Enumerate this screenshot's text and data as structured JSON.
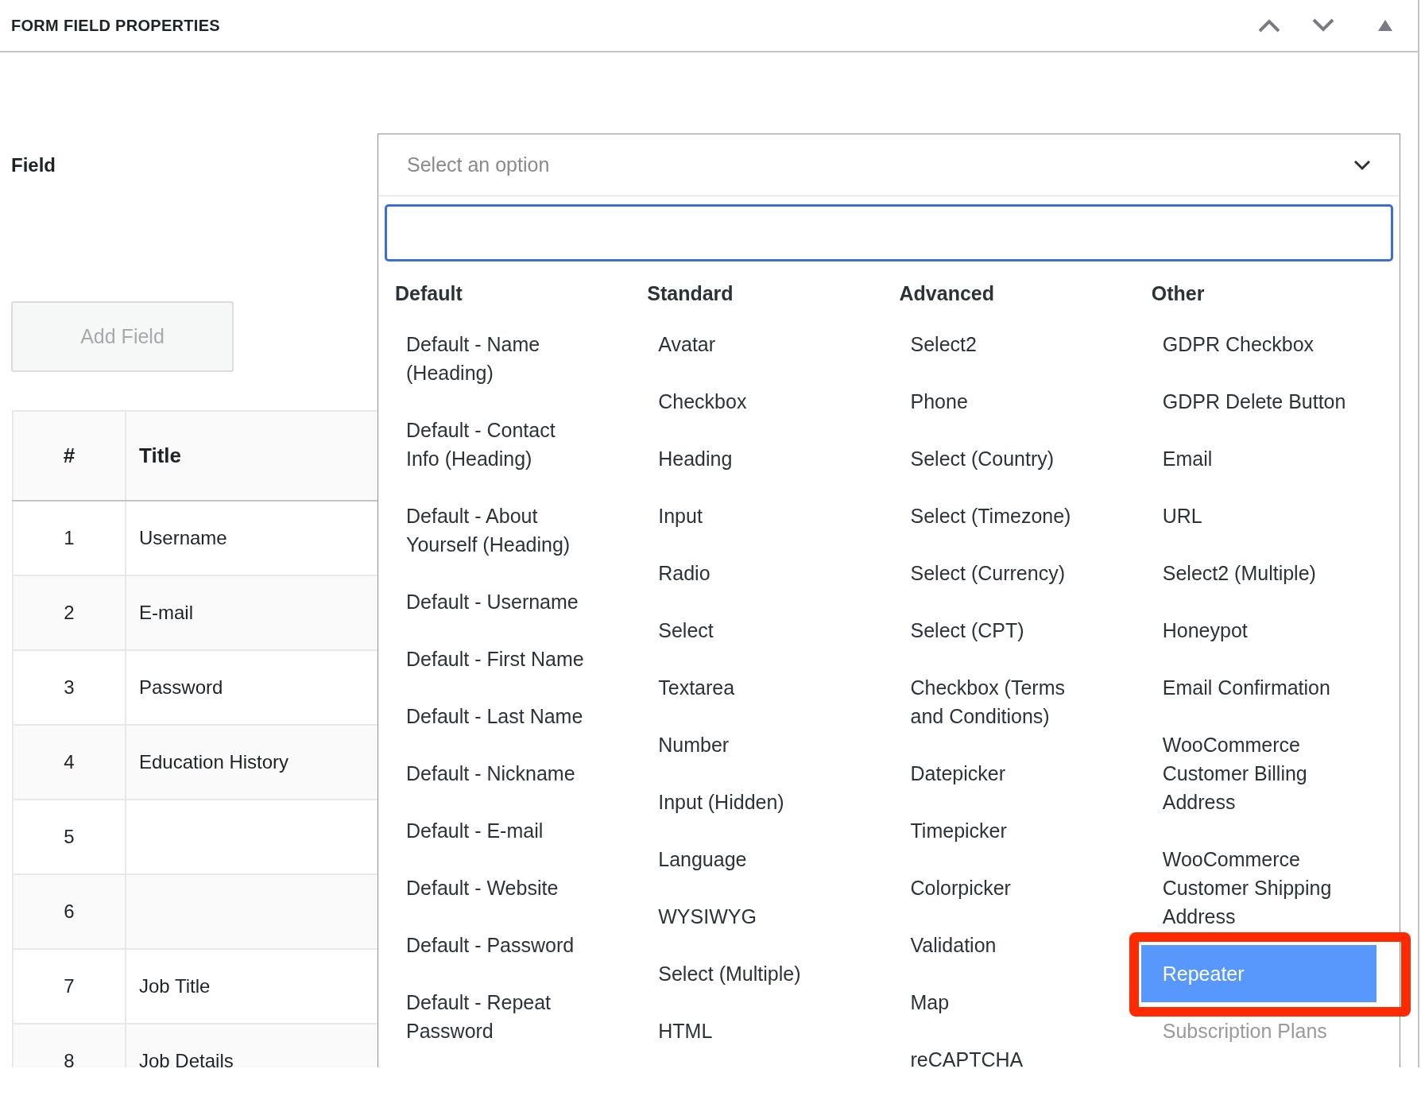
{
  "panel": {
    "title": "FORM FIELD PROPERTIES",
    "controls": [
      {
        "kind": "chevron-up"
      },
      {
        "kind": "chevron-down"
      },
      {
        "kind": "collapse"
      }
    ]
  },
  "field": {
    "label": "Field",
    "select": {
      "placeholder": "Select an option",
      "expanded": true
    }
  },
  "option_groups": [
    {
      "heading": "Default",
      "options": [
        {
          "label": "Default - Name (Heading)",
          "highlighted": false,
          "disabled": false,
          "annotated": false
        },
        {
          "label": "Default - Contact Info (Heading)",
          "highlighted": false,
          "disabled": false,
          "annotated": false
        },
        {
          "label": "Default - About Yourself (Heading)",
          "highlighted": false,
          "disabled": false,
          "annotated": false
        },
        {
          "label": "Default - Username",
          "highlighted": false,
          "disabled": false,
          "annotated": false
        },
        {
          "label": "Default - First Name",
          "highlighted": false,
          "disabled": false,
          "annotated": false
        },
        {
          "label": "Default - Last Name",
          "highlighted": false,
          "disabled": false,
          "annotated": false
        },
        {
          "label": "Default - Nickname",
          "highlighted": false,
          "disabled": false,
          "annotated": false
        },
        {
          "label": "Default - E-mail",
          "highlighted": false,
          "disabled": false,
          "annotated": false
        },
        {
          "label": "Default - Website",
          "highlighted": false,
          "disabled": false,
          "annotated": false
        },
        {
          "label": "Default - Password",
          "highlighted": false,
          "disabled": false,
          "annotated": false
        },
        {
          "label": "Default - Repeat Password",
          "highlighted": false,
          "disabled": false,
          "annotated": false
        }
      ]
    },
    {
      "heading": "Standard",
      "options": [
        {
          "label": "Avatar",
          "highlighted": false,
          "disabled": false,
          "annotated": false
        },
        {
          "label": "Checkbox",
          "highlighted": false,
          "disabled": false,
          "annotated": false
        },
        {
          "label": "Heading",
          "highlighted": false,
          "disabled": false,
          "annotated": false
        },
        {
          "label": "Input",
          "highlighted": false,
          "disabled": false,
          "annotated": false
        },
        {
          "label": "Radio",
          "highlighted": false,
          "disabled": false,
          "annotated": false
        },
        {
          "label": "Select",
          "highlighted": false,
          "disabled": false,
          "annotated": false
        },
        {
          "label": "Textarea",
          "highlighted": false,
          "disabled": false,
          "annotated": false
        },
        {
          "label": "Number",
          "highlighted": false,
          "disabled": false,
          "annotated": false
        },
        {
          "label": "Input (Hidden)",
          "highlighted": false,
          "disabled": false,
          "annotated": false
        },
        {
          "label": "Language",
          "highlighted": false,
          "disabled": false,
          "annotated": false
        },
        {
          "label": "WYSIWYG",
          "highlighted": false,
          "disabled": false,
          "annotated": false
        },
        {
          "label": "Select (Multiple)",
          "highlighted": false,
          "disabled": false,
          "annotated": false
        },
        {
          "label": "HTML",
          "highlighted": false,
          "disabled": false,
          "annotated": false
        }
      ]
    },
    {
      "heading": "Advanced",
      "options": [
        {
          "label": "Select2",
          "highlighted": false,
          "disabled": false,
          "annotated": false
        },
        {
          "label": "Phone",
          "highlighted": false,
          "disabled": false,
          "annotated": false
        },
        {
          "label": "Select (Country)",
          "highlighted": false,
          "disabled": false,
          "annotated": false
        },
        {
          "label": "Select (Timezone)",
          "highlighted": false,
          "disabled": false,
          "annotated": false
        },
        {
          "label": "Select (Currency)",
          "highlighted": false,
          "disabled": false,
          "annotated": false
        },
        {
          "label": "Select (CPT)",
          "highlighted": false,
          "disabled": false,
          "annotated": false
        },
        {
          "label": "Checkbox (Terms and Conditions)",
          "highlighted": false,
          "disabled": false,
          "annotated": false
        },
        {
          "label": "Datepicker",
          "highlighted": false,
          "disabled": false,
          "annotated": false
        },
        {
          "label": "Timepicker",
          "highlighted": false,
          "disabled": false,
          "annotated": false
        },
        {
          "label": "Colorpicker",
          "highlighted": false,
          "disabled": false,
          "annotated": false
        },
        {
          "label": "Validation",
          "highlighted": false,
          "disabled": false,
          "annotated": false
        },
        {
          "label": "Map",
          "highlighted": false,
          "disabled": false,
          "annotated": false
        },
        {
          "label": "reCAPTCHA",
          "highlighted": false,
          "disabled": false,
          "annotated": false
        }
      ]
    },
    {
      "heading": "Other",
      "options": [
        {
          "label": "GDPR Checkbox",
          "highlighted": false,
          "disabled": false,
          "annotated": false
        },
        {
          "label": "GDPR Delete Button",
          "highlighted": false,
          "disabled": false,
          "annotated": false
        },
        {
          "label": "Email",
          "highlighted": false,
          "disabled": false,
          "annotated": false
        },
        {
          "label": "URL",
          "highlighted": false,
          "disabled": false,
          "annotated": false
        },
        {
          "label": "Select2 (Multiple)",
          "highlighted": false,
          "disabled": false,
          "annotated": false
        },
        {
          "label": "Honeypot",
          "highlighted": false,
          "disabled": false,
          "annotated": false
        },
        {
          "label": "Email Confirmation",
          "highlighted": false,
          "disabled": false,
          "annotated": false
        },
        {
          "label": "WooCommerce Customer Billing Address",
          "highlighted": false,
          "disabled": false,
          "annotated": false
        },
        {
          "label": "WooCommerce Customer Shipping Address",
          "highlighted": false,
          "disabled": false,
          "annotated": false
        },
        {
          "label": "Repeater",
          "highlighted": true,
          "disabled": false,
          "annotated": true
        },
        {
          "label": "Subscription Plans",
          "highlighted": false,
          "disabled": true,
          "annotated": false
        }
      ]
    }
  ],
  "add_button": {
    "label": "Add Field",
    "disabled": true
  },
  "table": {
    "columns": [
      "#",
      "Title"
    ],
    "rows": [
      {
        "number": "1",
        "title": "Username"
      },
      {
        "number": "2",
        "title": "E-mail"
      },
      {
        "number": "3",
        "title": "Password"
      },
      {
        "number": "4",
        "title": "Education History"
      },
      {
        "number": "5"
      },
      {
        "number": "6"
      },
      {
        "number": "7",
        "title": "Job Title"
      },
      {
        "number": "8",
        "title": "Job Details"
      }
    ]
  }
}
